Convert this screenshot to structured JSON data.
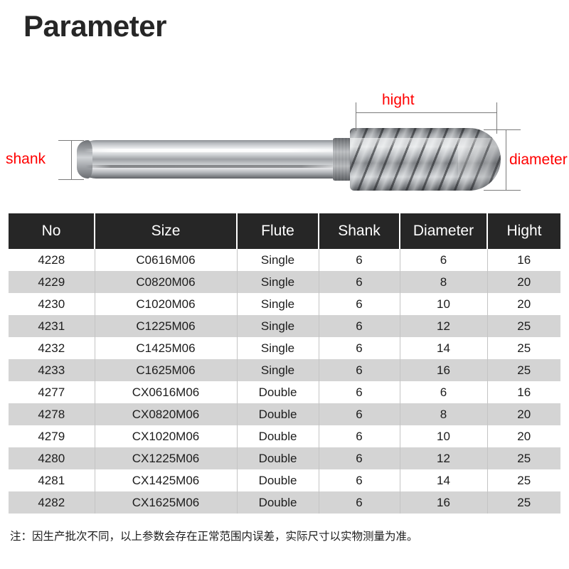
{
  "page": {
    "title": "Parameter"
  },
  "figure": {
    "labels": {
      "shank": "shank",
      "hight": "hight",
      "diameter": "diameter"
    },
    "annotation_color": "#ff0000",
    "dimension_line_color": "#7a7a7a",
    "product": "carbide-rotary-burr-cylindrical-ball-nose"
  },
  "table": {
    "headers": [
      "No",
      "Size",
      "Flute",
      "Shank",
      "Diameter",
      "Hight"
    ],
    "header_bg": "#262626",
    "header_text_color": "#ffffff",
    "stripe_color": "#d4d4d4",
    "rows": [
      {
        "no": "4228",
        "size": "C0616M06",
        "flute": "Single",
        "shank": "6",
        "diameter": "6",
        "hight": "16"
      },
      {
        "no": "4229",
        "size": "C0820M06",
        "flute": "Single",
        "shank": "6",
        "diameter": "8",
        "hight": "20"
      },
      {
        "no": "4230",
        "size": "C1020M06",
        "flute": "Single",
        "shank": "6",
        "diameter": "10",
        "hight": "20"
      },
      {
        "no": "4231",
        "size": "C1225M06",
        "flute": "Single",
        "shank": "6",
        "diameter": "12",
        "hight": "25"
      },
      {
        "no": "4232",
        "size": "C1425M06",
        "flute": "Single",
        "shank": "6",
        "diameter": "14",
        "hight": "25"
      },
      {
        "no": "4233",
        "size": "C1625M06",
        "flute": "Single",
        "shank": "6",
        "diameter": "16",
        "hight": "25"
      },
      {
        "no": "4277",
        "size": "CX0616M06",
        "flute": "Double",
        "shank": "6",
        "diameter": "6",
        "hight": "16"
      },
      {
        "no": "4278",
        "size": "CX0820M06",
        "flute": "Double",
        "shank": "6",
        "diameter": "8",
        "hight": "20"
      },
      {
        "no": "4279",
        "size": "CX1020M06",
        "flute": "Double",
        "shank": "6",
        "diameter": "10",
        "hight": "20"
      },
      {
        "no": "4280",
        "size": "CX1225M06",
        "flute": "Double",
        "shank": "6",
        "diameter": "12",
        "hight": "25"
      },
      {
        "no": "4281",
        "size": "CX1425M06",
        "flute": "Double",
        "shank": "6",
        "diameter": "14",
        "hight": "25"
      },
      {
        "no": "4282",
        "size": "CX1625M06",
        "flute": "Double",
        "shank": "6",
        "diameter": "16",
        "hight": "25"
      }
    ]
  },
  "footnote": {
    "text": "注：因生产批次不同，以上参数会存在正常范围内误差，实际尺寸以实物测量为准。"
  }
}
